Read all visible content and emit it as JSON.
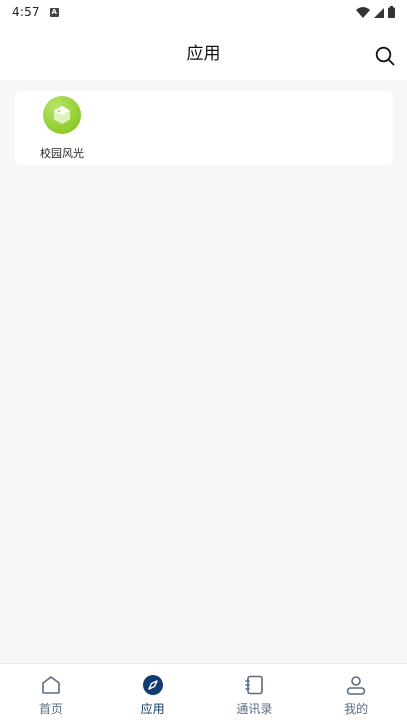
{
  "status_bar": {
    "time": "4:57",
    "a_glyph": "A",
    "icons": [
      "wifi-icon",
      "signal-icon",
      "battery-icon"
    ]
  },
  "header": {
    "title": "应用",
    "search_icon": "search-icon"
  },
  "apps": [
    {
      "label": "校园风光",
      "icon": "campus-scenery-app-icon",
      "color": "#8fcc2a"
    }
  ],
  "bottom_nav": {
    "active_index": 1,
    "active_color": "#123a73",
    "inactive_color": "#5a6b80",
    "items": [
      {
        "label": "首页",
        "icon": "home-icon"
      },
      {
        "label": "应用",
        "icon": "compass-icon"
      },
      {
        "label": "通讯录",
        "icon": "contacts-icon"
      },
      {
        "label": "我的",
        "icon": "profile-icon"
      }
    ]
  }
}
